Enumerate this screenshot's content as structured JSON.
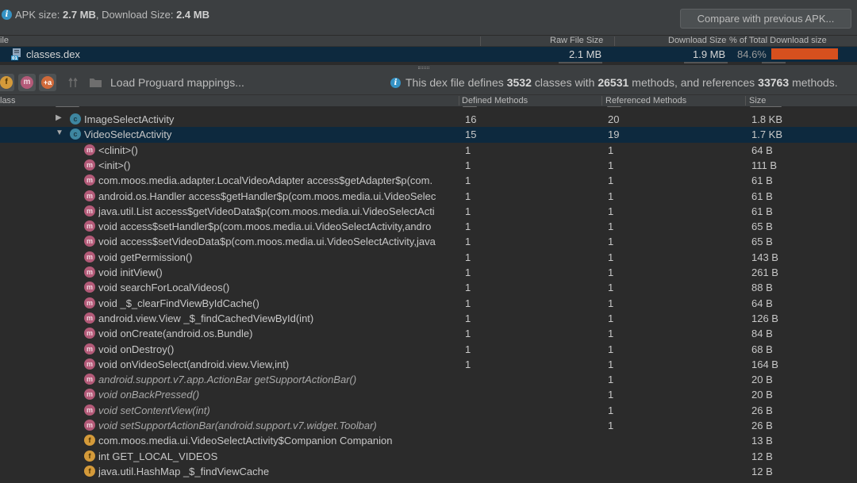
{
  "apk_summary": {
    "apk_size_label": "APK size:",
    "apk_size": "2.7 MB",
    "download_size_label": ", Download Size:",
    "download_size": "2.4 MB"
  },
  "compare_button": "Compare with previous APK...",
  "file_table": {
    "headers": {
      "file": "ile",
      "raw_size": "Raw File Size",
      "download_size": "Download Size",
      "pct_total": "% of Total Download size"
    },
    "row": {
      "name": "classes.dex",
      "raw_size": "2.1 MB",
      "download_size": "1.9 MB",
      "pct": "84.6%",
      "pct_value": 84.6
    }
  },
  "toolbar": {
    "load_proguard": "Load Proguard mappings...",
    "dex_info": {
      "prefix": "This dex file defines",
      "classes": "3532",
      "mid1": "classes with",
      "methods": "26531",
      "mid2": "methods, and references",
      "refs": "33763",
      "suffix": "methods."
    }
  },
  "class_table": {
    "headers": {
      "class": "lass",
      "defined": "Defined Methods",
      "referenced": "Referenced Methods",
      "size": "Size"
    },
    "rows": [
      {
        "kind": "c",
        "arrow": "▶",
        "name": "ImageSelectActivity",
        "defined": "16",
        "referenced": "20",
        "size": "1.8 KB",
        "indent": 0
      },
      {
        "kind": "c",
        "arrow": "▼",
        "name": "VideoSelectActivity",
        "defined": "15",
        "referenced": "19",
        "size": "1.7 KB",
        "indent": 0,
        "selected": true
      },
      {
        "kind": "m",
        "name": "<clinit>()",
        "defined": "1",
        "referenced": "1",
        "size": "64 B",
        "indent": 1
      },
      {
        "kind": "m",
        "name": "<init>()",
        "defined": "1",
        "referenced": "1",
        "size": "111 B",
        "indent": 1
      },
      {
        "kind": "m",
        "name": "com.moos.media.adapter.LocalVideoAdapter access$getAdapter$p(com.",
        "defined": "1",
        "referenced": "1",
        "size": "61 B",
        "indent": 1
      },
      {
        "kind": "m",
        "name": "android.os.Handler access$getHandler$p(com.moos.media.ui.VideoSelec",
        "defined": "1",
        "referenced": "1",
        "size": "61 B",
        "indent": 1
      },
      {
        "kind": "m",
        "name": "java.util.List access$getVideoData$p(com.moos.media.ui.VideoSelectActi",
        "defined": "1",
        "referenced": "1",
        "size": "61 B",
        "indent": 1
      },
      {
        "kind": "m",
        "name": "void access$setHandler$p(com.moos.media.ui.VideoSelectActivity,andro",
        "defined": "1",
        "referenced": "1",
        "size": "65 B",
        "indent": 1
      },
      {
        "kind": "m",
        "name": "void access$setVideoData$p(com.moos.media.ui.VideoSelectActivity,java",
        "defined": "1",
        "referenced": "1",
        "size": "65 B",
        "indent": 1
      },
      {
        "kind": "m",
        "name": "void getPermission()",
        "defined": "1",
        "referenced": "1",
        "size": "143 B",
        "indent": 1
      },
      {
        "kind": "m",
        "name": "void initView()",
        "defined": "1",
        "referenced": "1",
        "size": "261 B",
        "indent": 1
      },
      {
        "kind": "m",
        "name": "void searchForLocalVideos()",
        "defined": "1",
        "referenced": "1",
        "size": "88 B",
        "indent": 1
      },
      {
        "kind": "m",
        "name": "void _$_clearFindViewByIdCache()",
        "defined": "1",
        "referenced": "1",
        "size": "64 B",
        "indent": 1
      },
      {
        "kind": "m",
        "name": "android.view.View _$_findCachedViewById(int)",
        "defined": "1",
        "referenced": "1",
        "size": "126 B",
        "indent": 1
      },
      {
        "kind": "m",
        "name": "void onCreate(android.os.Bundle)",
        "defined": "1",
        "referenced": "1",
        "size": "84 B",
        "indent": 1
      },
      {
        "kind": "m",
        "name": "void onDestroy()",
        "defined": "1",
        "referenced": "1",
        "size": "68 B",
        "indent": 1
      },
      {
        "kind": "m",
        "name": "void onVideoSelect(android.view.View,int)",
        "defined": "1",
        "referenced": "1",
        "size": "164 B",
        "indent": 1
      },
      {
        "kind": "m",
        "name": "android.support.v7.app.ActionBar getSupportActionBar()",
        "defined": "",
        "referenced": "1",
        "size": "20 B",
        "indent": 1,
        "italic": true
      },
      {
        "kind": "m",
        "name": "void onBackPressed()",
        "defined": "",
        "referenced": "1",
        "size": "20 B",
        "indent": 1,
        "italic": true
      },
      {
        "kind": "m",
        "name": "void setContentView(int)",
        "defined": "",
        "referenced": "1",
        "size": "26 B",
        "indent": 1,
        "italic": true
      },
      {
        "kind": "m",
        "name": "void setSupportActionBar(android.support.v7.widget.Toolbar)",
        "defined": "",
        "referenced": "1",
        "size": "26 B",
        "indent": 1,
        "italic": true
      },
      {
        "kind": "f",
        "name": "com.moos.media.ui.VideoSelectActivity$Companion Companion",
        "defined": "",
        "referenced": "",
        "size": "13 B",
        "indent": 1
      },
      {
        "kind": "f",
        "name": "int GET_LOCAL_VIDEOS",
        "defined": "",
        "referenced": "",
        "size": "12 B",
        "indent": 1
      },
      {
        "kind": "f",
        "name": "java.util.HashMap _$_findViewCache",
        "defined": "",
        "referenced": "",
        "size": "12 B",
        "indent": 1
      }
    ]
  },
  "colors": {
    "background": "#2b2b2b",
    "panel": "#3c3f41",
    "selection": "#0d293e",
    "bar": "#d6501e",
    "class_icon": "#3e86a0",
    "method_icon": "#b35a78",
    "field_icon": "#d49a3a"
  },
  "icons": {
    "info": "info-icon",
    "dex_file": "dex-file-icon",
    "class": "class-icon",
    "method": "method-icon",
    "field": "field-icon",
    "filter_fields": "filter-fields-icon",
    "filter_methods": "filter-methods-icon",
    "filter_references": "filter-references-icon",
    "show_removed": "show-removed-icon",
    "folder": "folder-icon"
  }
}
